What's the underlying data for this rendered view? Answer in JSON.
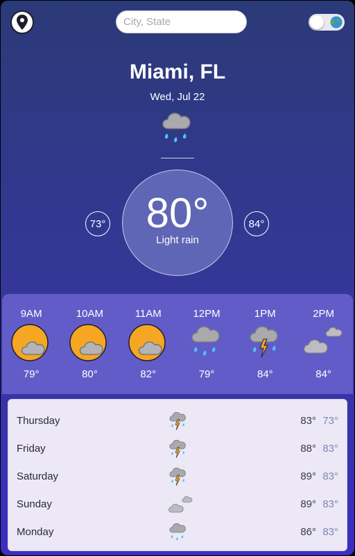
{
  "header": {
    "search_placeholder": "City, State"
  },
  "current": {
    "city": "Miami, FL",
    "date": "Wed, Jul 22",
    "temp": "80°",
    "condition": "Light rain",
    "low": "73°",
    "high": "84°",
    "icon": "rain-cloud-icon"
  },
  "hourly": [
    {
      "time": "9AM",
      "temp": "79°",
      "icon": "sun-cloud-icon"
    },
    {
      "time": "10AM",
      "temp": "80°",
      "icon": "sun-cloud-icon"
    },
    {
      "time": "11AM",
      "temp": "82°",
      "icon": "sun-cloud-icon"
    },
    {
      "time": "12PM",
      "temp": "79°",
      "icon": "rain-cloud-icon"
    },
    {
      "time": "1PM",
      "temp": "84°",
      "icon": "thunderstorm-icon"
    },
    {
      "time": "2PM",
      "temp": "84°",
      "icon": "clouds-icon"
    }
  ],
  "daily": [
    {
      "day": "Thursday",
      "high": "83°",
      "low": "73°",
      "icon": "thunderstorm-icon"
    },
    {
      "day": "Friday",
      "high": "88°",
      "low": "83°",
      "icon": "thunderstorm-icon"
    },
    {
      "day": "Saturday",
      "high": "89°",
      "low": "83°",
      "icon": "thunderstorm-icon"
    },
    {
      "day": "Sunday",
      "high": "89°",
      "low": "83°",
      "icon": "clouds-icon"
    },
    {
      "day": "Monday",
      "high": "86°",
      "low": "83°",
      "icon": "rain-cloud-icon"
    }
  ],
  "colors": {
    "background_top": "#2b3a78",
    "background_bottom": "#3b2ec0",
    "hourly_panel": "#625cc8",
    "daily_panel": "#ece8f6",
    "sun": "#f5a623",
    "rain": "#4fc3f7",
    "lightning": "#f5a623"
  }
}
